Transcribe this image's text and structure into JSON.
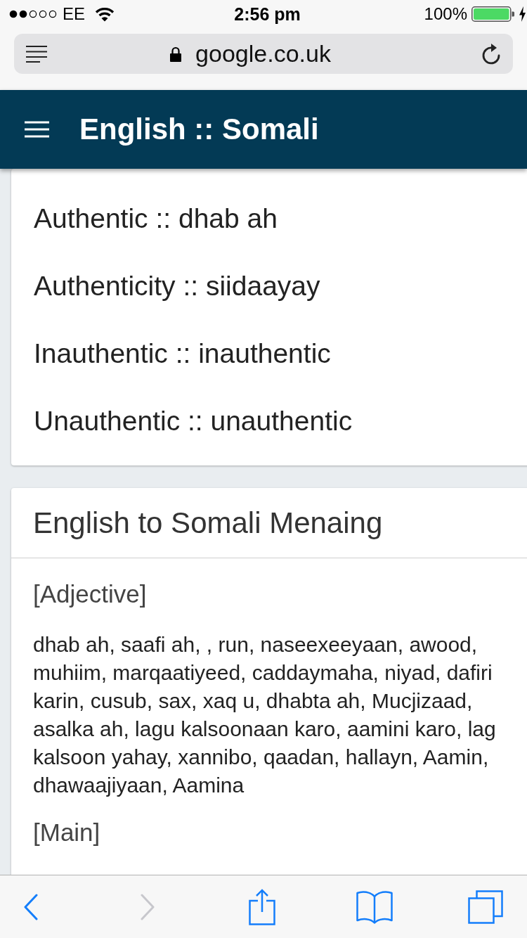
{
  "status_bar": {
    "carrier": "EE",
    "time": "2:56 pm",
    "battery": "100%"
  },
  "address_bar": {
    "url": "google.co.uk"
  },
  "header": {
    "title": "English :: Somali"
  },
  "results": [
    "Authentic :: dhab ah",
    "Authenticity :: siidaayay",
    "Inauthentic :: inauthentic",
    "Unauthentic :: unauthentic"
  ],
  "meaning_card": {
    "title": "English to Somali Menaing",
    "sections": [
      {
        "heading": "[Adjective]",
        "text": "dhab ah, saafi ah, , run, naseexeeyaan, awood, muhiim, marqaatiyeed, caddaymaha, niyad, dafiri karin, cusub, sax, xaq u, dhabta ah, Mucjizaad, asalka ah, lagu kalsoonaan karo, aamini karo, lag kalsoon yahay, xannibo, qaadan, hallayn, Aamin, dhawaajiyaan, Aamina"
      },
      {
        "heading": "[Main]"
      }
    ]
  },
  "toolbar": {
    "buttons": [
      {
        "kind": "back",
        "disabled": false
      },
      {
        "kind": "forward",
        "disabled": true
      },
      {
        "kind": "share",
        "disabled": false
      },
      {
        "kind": "bookmarks",
        "disabled": false
      },
      {
        "kind": "tabs",
        "disabled": false
      }
    ]
  }
}
